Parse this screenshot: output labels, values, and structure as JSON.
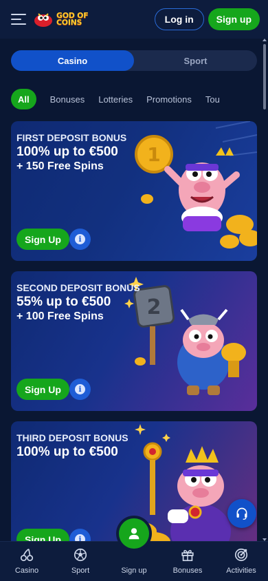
{
  "header": {
    "logo_line1": "GOD OF",
    "logo_line2": "COINS",
    "login_label": "Log in",
    "signup_label": "Sign up"
  },
  "segment": {
    "tabs": [
      {
        "label": "Casino",
        "active": true
      },
      {
        "label": "Sport",
        "active": false
      }
    ]
  },
  "filters": [
    {
      "label": "All",
      "active": true
    },
    {
      "label": "Bonuses"
    },
    {
      "label": "Lotteries"
    },
    {
      "label": "Promotions"
    },
    {
      "label": "Tou"
    }
  ],
  "promos": [
    {
      "title": "FIRST DEPOSIT BONUS",
      "amount": "100% up to €500",
      "extra": "+ 150 Free Spins",
      "button": "Sign Up",
      "info_icon": "info-icon"
    },
    {
      "title": "SECOND DEPOSIT BONUS",
      "amount": "55% up to €500",
      "extra": "+ 100 Free Spins",
      "button": "Sign Up",
      "info_icon": "info-icon",
      "art_badge": "2"
    },
    {
      "title": "THIRD DEPOSIT BONUS",
      "amount": "100% up to €500",
      "extra": "",
      "button": "Sign Up",
      "info_icon": "info-icon"
    }
  ],
  "bottom_nav": [
    {
      "label": "Casino",
      "icon": "cherries-icon"
    },
    {
      "label": "Sport",
      "icon": "soccer-ball-icon"
    },
    {
      "label": "Sign up",
      "icon": "user-icon"
    },
    {
      "label": "Bonuses",
      "icon": "gift-icon"
    },
    {
      "label": "Activities",
      "icon": "target-icon"
    }
  ],
  "colors": {
    "background": "#0a1733",
    "accent_green": "#16a61c",
    "accent_blue": "#1151c9",
    "logo_yellow": "#ffcc2e"
  }
}
